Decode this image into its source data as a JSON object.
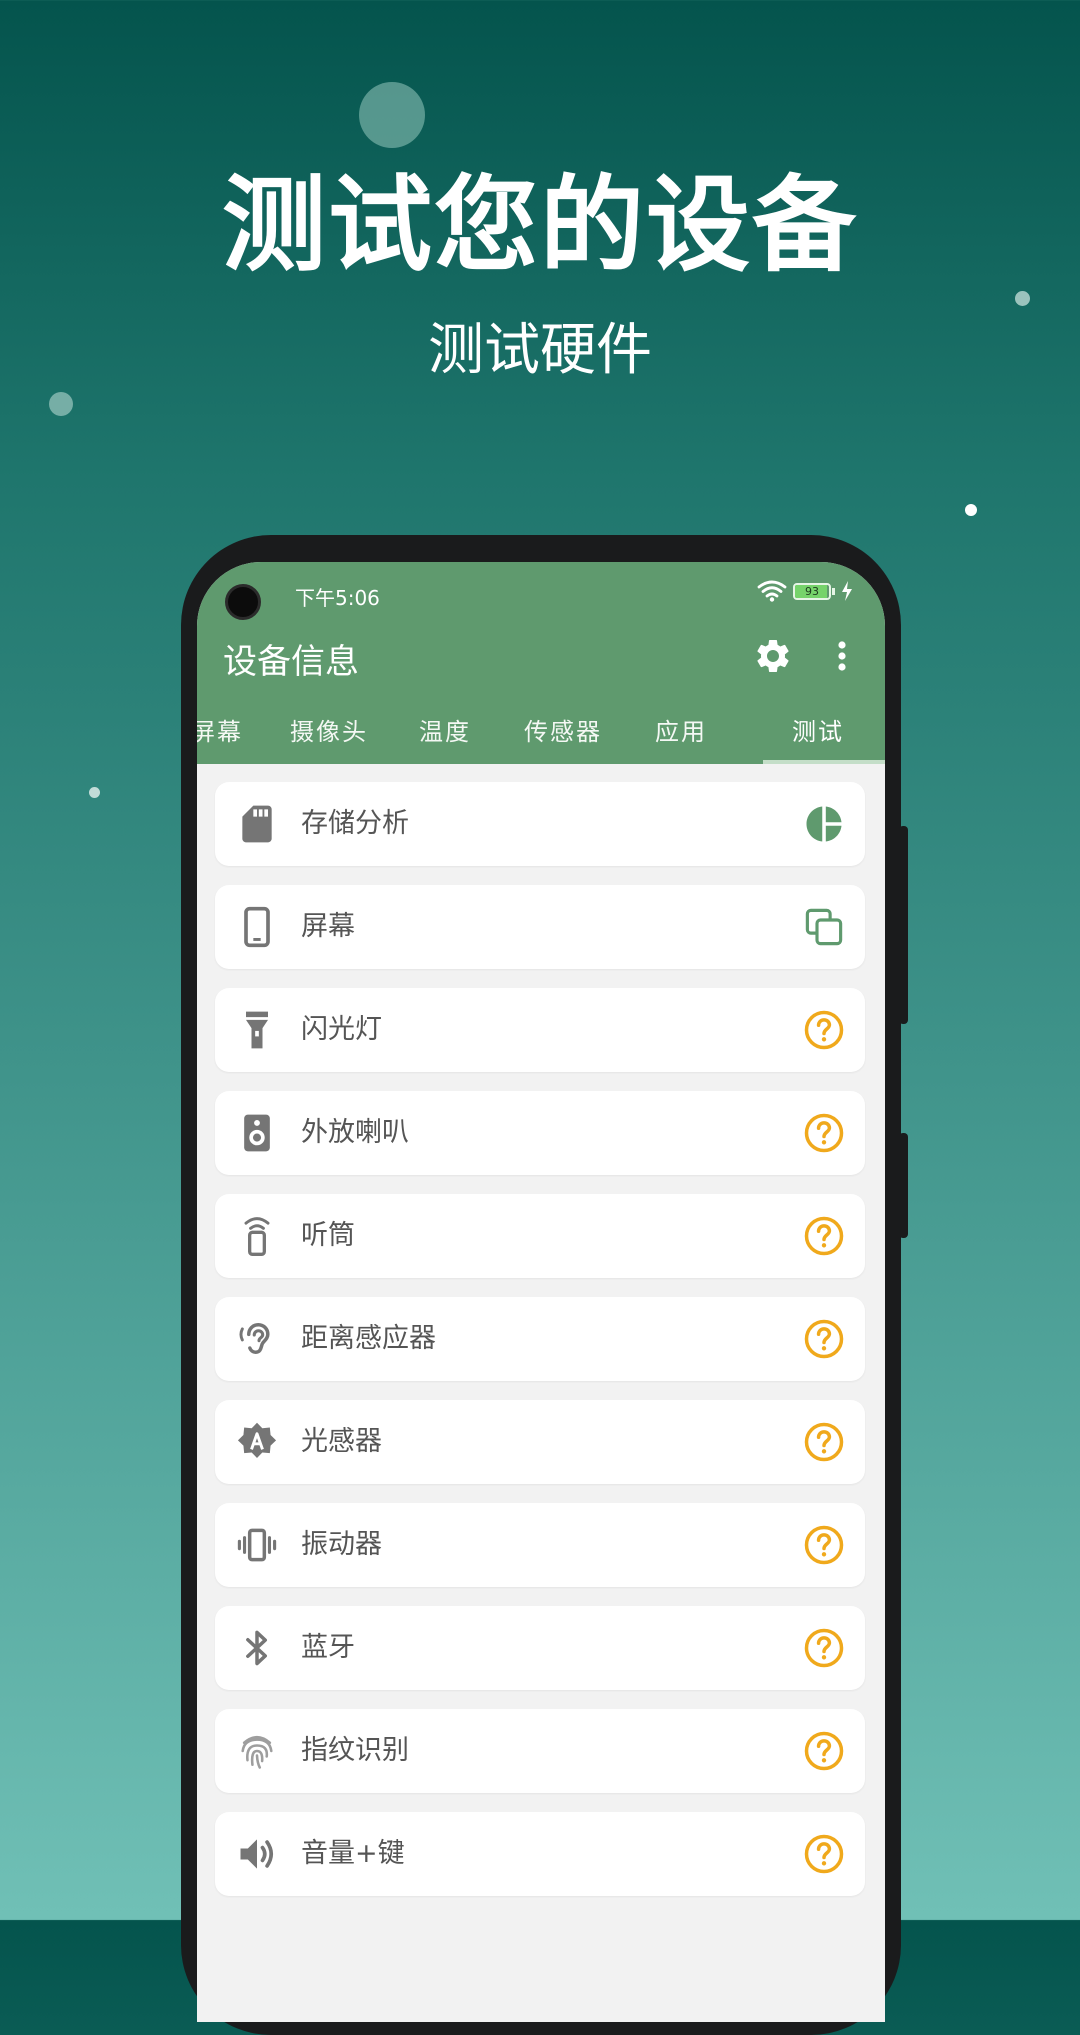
{
  "promo": {
    "headline": "测试您的设备",
    "subheadline": "测试硬件"
  },
  "status_bar": {
    "time": "下午5:06",
    "battery_level": "93",
    "icons": [
      "wifi-icon",
      "battery-icon",
      "charging-icon"
    ]
  },
  "app_bar": {
    "title": "设备信息",
    "icons": [
      "gear-icon",
      "more-vert-icon"
    ]
  },
  "tabs": [
    {
      "label": "屏幕"
    },
    {
      "label": "摄像头"
    },
    {
      "label": "温度"
    },
    {
      "label": "传感器"
    },
    {
      "label": "应用"
    },
    {
      "label": "测试"
    }
  ],
  "selected_tab": "测试",
  "tests": [
    {
      "label": "存储分析",
      "icon": "sd-card-icon",
      "action": "pie-chart-icon"
    },
    {
      "label": "屏幕",
      "icon": "phone-icon",
      "action": "copy-icon"
    },
    {
      "label": "闪光灯",
      "icon": "flashlight-icon",
      "action": "question-icon"
    },
    {
      "label": "外放喇叭",
      "icon": "speaker-icon",
      "action": "question-icon"
    },
    {
      "label": "听筒",
      "icon": "earpiece-icon",
      "action": "question-icon"
    },
    {
      "label": "距离感应器",
      "icon": "ear-icon",
      "action": "question-icon"
    },
    {
      "label": "光感器",
      "icon": "brightness-auto-icon",
      "action": "question-icon"
    },
    {
      "label": "振动器",
      "icon": "vibration-icon",
      "action": "question-icon"
    },
    {
      "label": "蓝牙",
      "icon": "bluetooth-icon",
      "action": "question-icon"
    },
    {
      "label": "指纹识别",
      "icon": "fingerprint-icon",
      "action": "question-icon"
    },
    {
      "label": "音量+键",
      "icon": "volume-icon",
      "action": "question-icon"
    }
  ],
  "colors": {
    "app_bar": "#5f9a6e",
    "status_unknown": "#f0a91c",
    "accent_green": "#5f9a6e",
    "background_top": "#04544d",
    "background_bottom": "#70c0b6"
  }
}
